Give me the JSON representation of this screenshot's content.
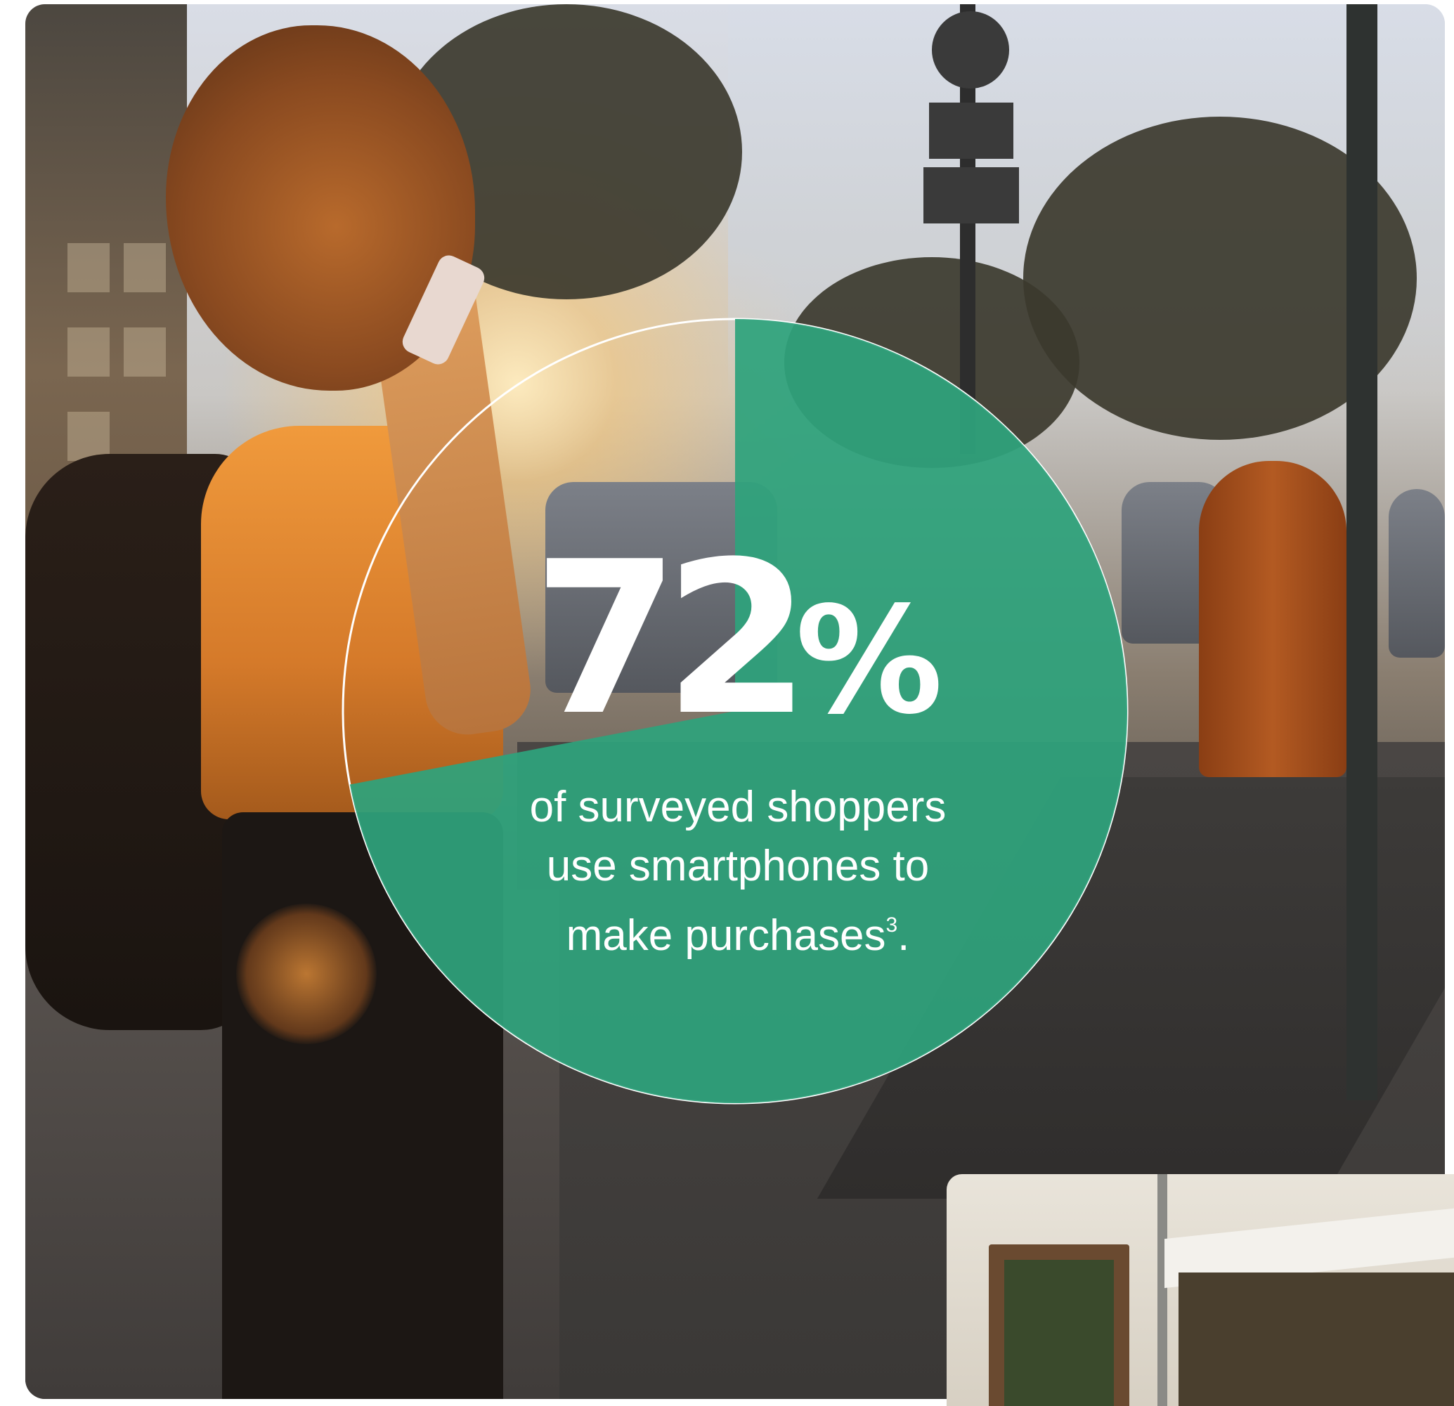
{
  "stat": {
    "value": 72,
    "number_text": "72",
    "percent_sign": "%",
    "caption_line1": "of surveyed shoppers",
    "caption_line2": "use smartphones to",
    "caption_line3": "make purchases",
    "footnote_marker": "3",
    "caption_end": "."
  },
  "colors": {
    "accent_green": "#2ea37c",
    "ring_white": "#ffffff"
  },
  "images": {
    "hero": "photo-woman-on-phone-street-sunset",
    "inset": "photo-storefront"
  }
}
